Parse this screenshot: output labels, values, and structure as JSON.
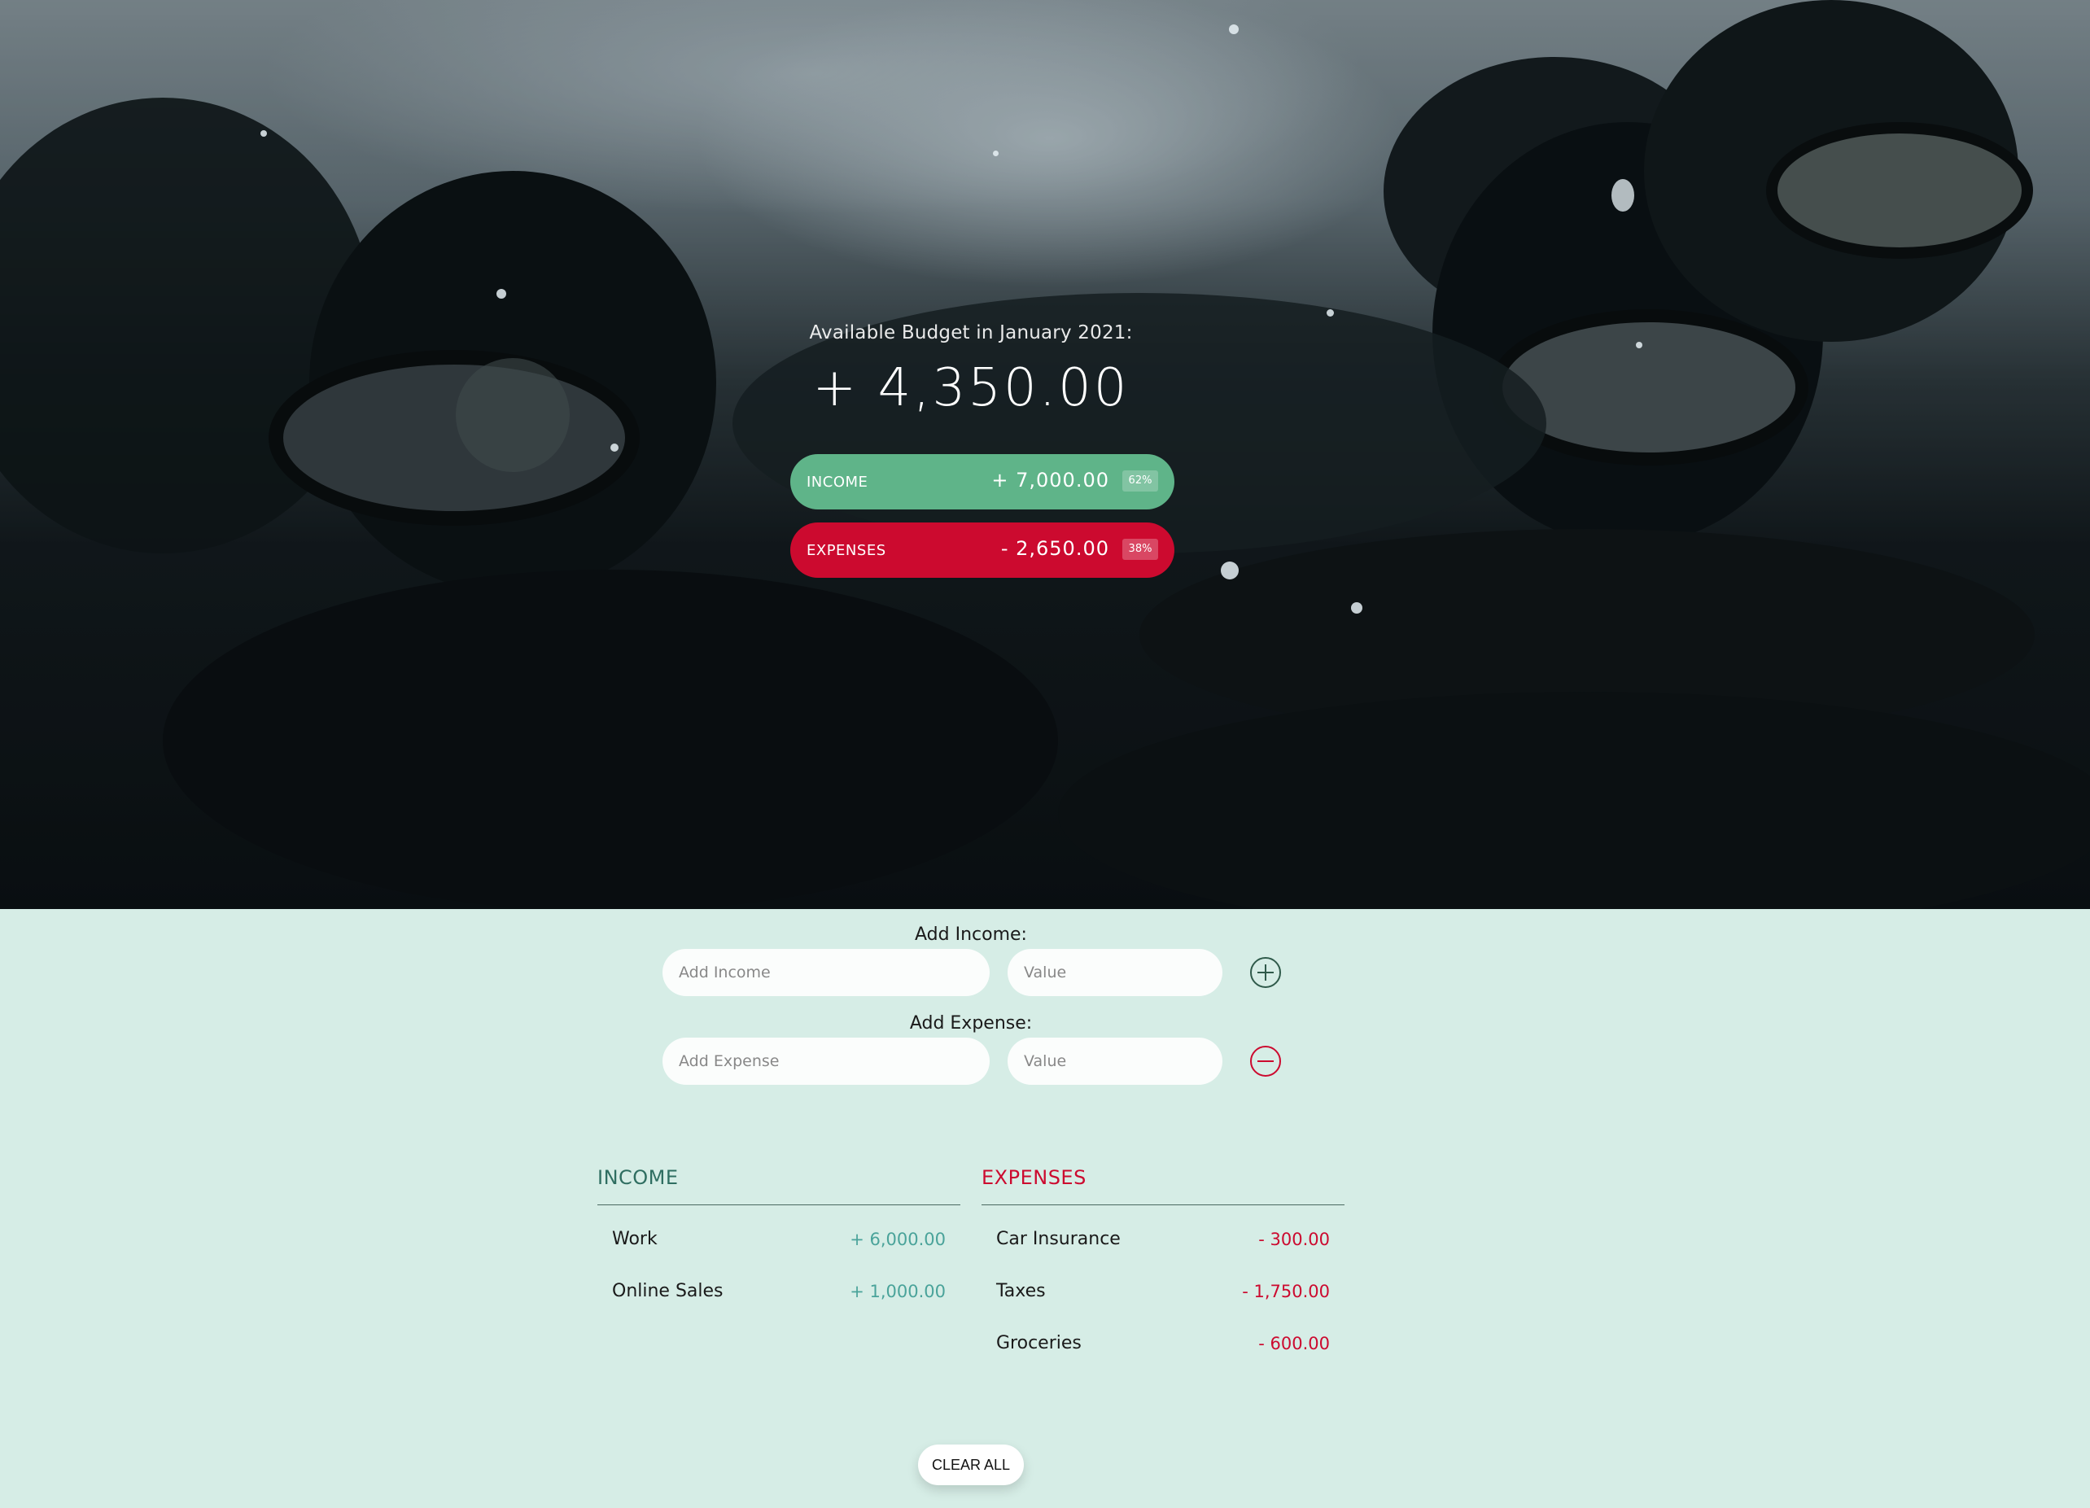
{
  "budget": {
    "title": "Available Budget in January 2021:",
    "value": "+ 4,350.00",
    "income": {
      "label": "INCOME",
      "value": "+ 7,000.00",
      "percent": "62%"
    },
    "expenses": {
      "label": "EXPENSES",
      "value": "- 2,650.00",
      "percent": "38%"
    }
  },
  "form": {
    "income_label": "Add Income:",
    "income_desc_placeholder": "Add Income",
    "income_value_placeholder": "Value",
    "expense_label": "Add Expense:",
    "expense_desc_placeholder": "Add Expense",
    "expense_value_placeholder": "Value"
  },
  "income_list": {
    "title": "INCOME",
    "items": [
      {
        "description": "Work",
        "value": "+ 6,000.00"
      },
      {
        "description": "Online Sales",
        "value": "+ 1,000.00"
      }
    ]
  },
  "expense_list": {
    "title": "EXPENSES",
    "items": [
      {
        "description": "Car Insurance",
        "value": "- 300.00"
      },
      {
        "description": "Taxes",
        "value": "- 1,750.00"
      },
      {
        "description": "Groceries",
        "value": "- 600.00"
      }
    ]
  },
  "clear_button": "CLEAR ALL",
  "colors": {
    "income": "#5fb489",
    "expense": "#cc0a2f",
    "background": "#d6ede6"
  }
}
